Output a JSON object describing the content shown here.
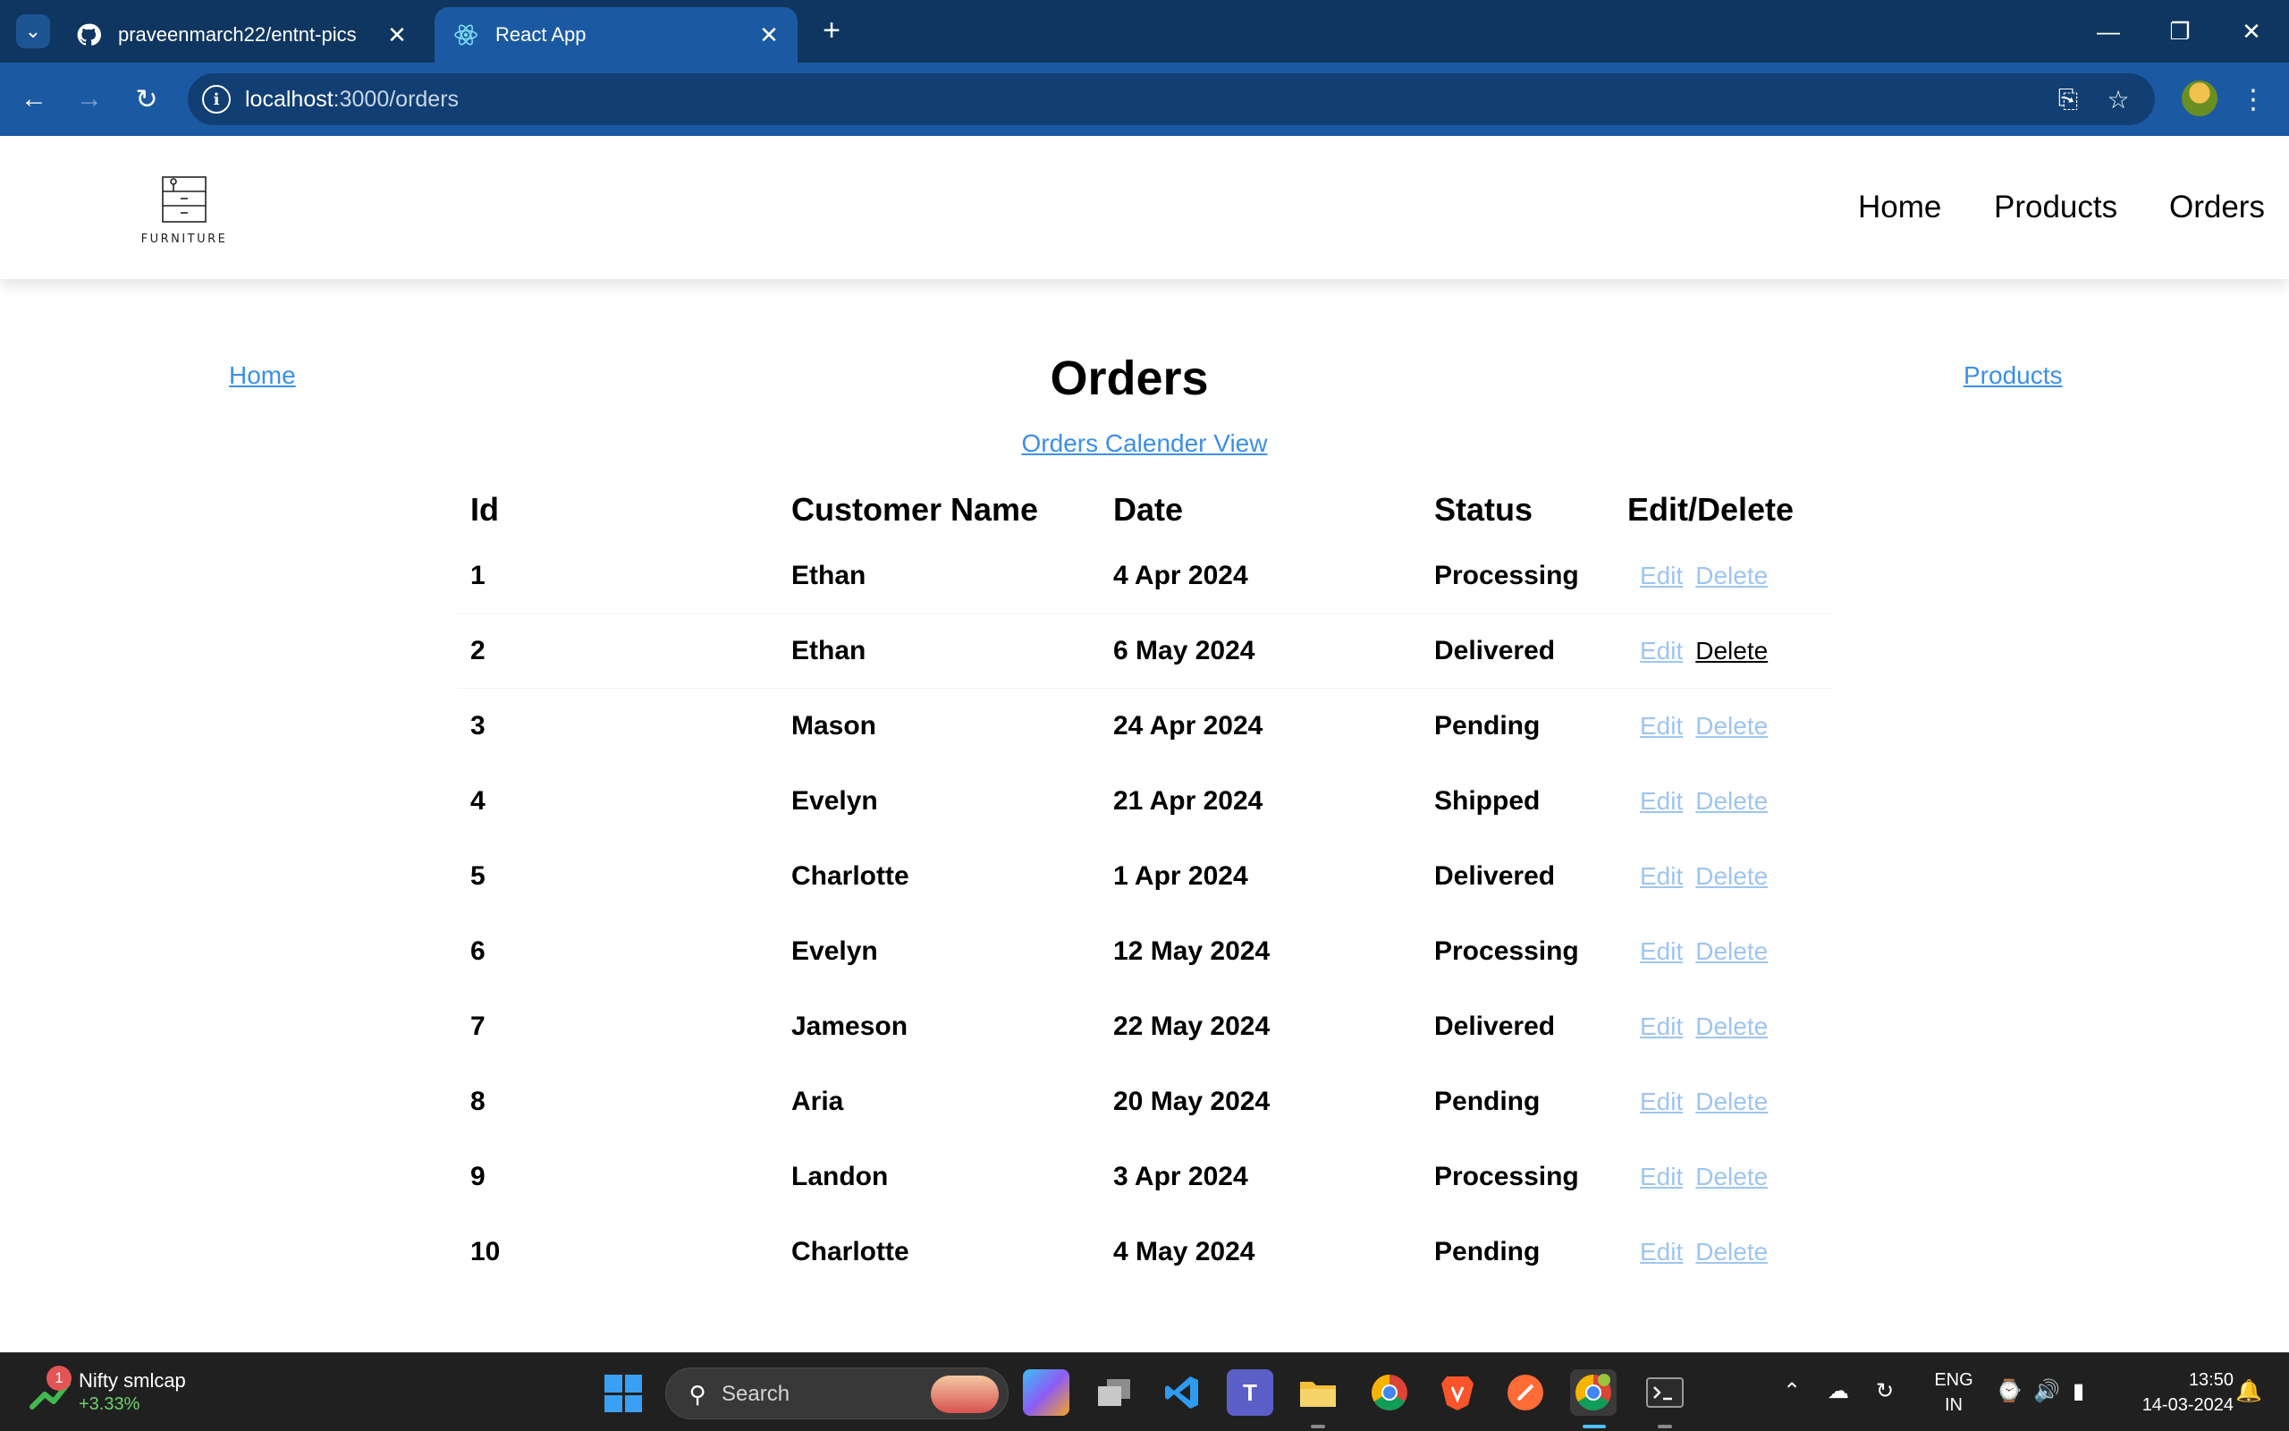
{
  "browser": {
    "tabs": [
      {
        "title": "praveenmarch22/entnt-pics",
        "favicon": "github-icon",
        "active": false
      },
      {
        "title": "React App",
        "favicon": "react-icon",
        "active": true
      }
    ],
    "url_host": "localhost",
    "url_path": ":3000/orders"
  },
  "header": {
    "logo_text": "FURNITURE",
    "nav": {
      "home": "Home",
      "products": "Products",
      "orders": "Orders"
    }
  },
  "page": {
    "home_link": "Home",
    "products_link": "Products",
    "title": "Orders",
    "calendar_link": "Orders Calender View"
  },
  "table": {
    "columns": {
      "id": "Id",
      "customer": "Customer Name",
      "date": "Date",
      "status": "Status",
      "actions": "Edit/Delete"
    },
    "edit_label": "Edit",
    "delete_label": "Delete",
    "rows": [
      {
        "id": "1",
        "customer": "Ethan",
        "date": "4 Apr 2024",
        "status": "Processing"
      },
      {
        "id": "2",
        "customer": "Ethan",
        "date": "6 May 2024",
        "status": "Delivered"
      },
      {
        "id": "3",
        "customer": "Mason",
        "date": "24 Apr 2024",
        "status": "Pending"
      },
      {
        "id": "4",
        "customer": "Evelyn",
        "date": "21 Apr 2024",
        "status": "Shipped"
      },
      {
        "id": "5",
        "customer": "Charlotte",
        "date": "1 Apr 2024",
        "status": "Delivered"
      },
      {
        "id": "6",
        "customer": "Evelyn",
        "date": "12 May 2024",
        "status": "Processing"
      },
      {
        "id": "7",
        "customer": "Jameson",
        "date": "22 May 2024",
        "status": "Delivered"
      },
      {
        "id": "8",
        "customer": "Aria",
        "date": "20 May 2024",
        "status": "Pending"
      },
      {
        "id": "9",
        "customer": "Landon",
        "date": "3 Apr 2024",
        "status": "Processing"
      },
      {
        "id": "10",
        "customer": "Charlotte",
        "date": "4 May 2024",
        "status": "Pending"
      }
    ]
  },
  "taskbar": {
    "widget_badge": "1",
    "widget_title": "Nifty smlcap",
    "widget_change": "+3.33%",
    "search_label": "Search",
    "lang_line1": "ENG",
    "lang_line2": "IN",
    "time": "13:50",
    "date": "14-03-2024"
  },
  "colors": {
    "tabbar": "#0f3661",
    "toolbar": "#1b5aa2",
    "link": "#3d8fe6",
    "action_link": "#9ec5ef",
    "taskbar": "#202020"
  }
}
